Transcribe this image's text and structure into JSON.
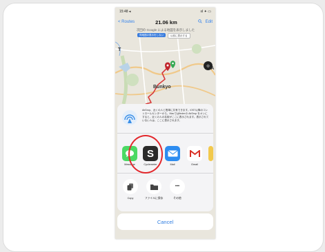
{
  "status_bar": {
    "time": "15:48 ◂",
    "indicators": "ııl ✦ ▭"
  },
  "nav": {
    "back_label": "< Routes",
    "title": "21.06 km",
    "edit_label": "Edit",
    "search_icon": "search-icon"
  },
  "map": {
    "google_notice": "次回の Google による地図を表示しました",
    "notice_primary": "同地図の表示をしない",
    "notice_secondary": "以前に表示する",
    "labels": {
      "city": "Bunkyo",
      "left_edge": "T",
      "right_edge": "A"
    },
    "compass_glyph": "◎",
    "accent_route": "#d83a3a"
  },
  "share_sheet": {
    "airdrop_text": "AirDrop、近くの人と簡単に共有できます。iOS7以降のコントロールセンターから、Macではfinderの AirDrop をオンにすると、近くの人の名前がここに表示されます。表示されていない人は、ここに表示されます。",
    "apps": [
      {
        "label": "Message",
        "icon": "message-icon",
        "color": "#4cd964"
      },
      {
        "label": "Cyclemeter",
        "icon": "cyclemeter-icon",
        "color": "#2a2a2a",
        "glyph": "S"
      },
      {
        "label": "Mail",
        "icon": "mail-icon",
        "color": "#2d8cf0"
      },
      {
        "label": "Gmail",
        "icon": "gmail-icon",
        "color": "#ffffff"
      }
    ],
    "actions": [
      {
        "label": "Copy",
        "icon": "copy-icon"
      },
      {
        "label": "ファイルに保存",
        "icon": "folder-icon"
      },
      {
        "label": "その他",
        "icon": "more-icon",
        "glyph": "•••"
      }
    ],
    "cancel_label": "Cancel"
  },
  "highlight": {
    "color": "#e3262b",
    "target": "Cyclemeter"
  }
}
